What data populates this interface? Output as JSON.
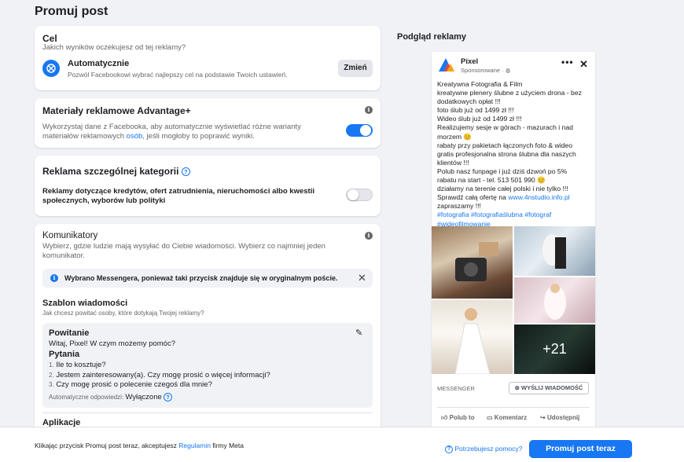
{
  "page": {
    "title": "Promuj post"
  },
  "goal": {
    "title": "Cel",
    "question": "Jakich wyników oczekujesz od tej reklamy?",
    "option_title": "Automatycznie",
    "option_desc": "Pozwól Facebookowi wybrać najlepszy cel na podstawie Twoich ustawień.",
    "change_label": "Zmień"
  },
  "advantage": {
    "title": "Materiały reklamowe Advantage+",
    "desc_1": "Wykorzystaj dane z Facebooka, aby automatycznie wyświetlać różne warianty",
    "desc_2a": "materiałów reklamowych ",
    "desc_link": "osób",
    "desc_2b": ", jeśli mogłoby to poprawić wyniki.",
    "enabled": true
  },
  "special": {
    "title": "Reklama szczególnej kategorii",
    "label_1": "Reklamy dotyczące kredytów, ofert zatrudnienia, nieruchomości albo kwestii",
    "label_2": "społecznych, wyborów lub polityki",
    "enabled": false
  },
  "messenger": {
    "title": "Komunikatory",
    "desc_1": "Wybierz, gdzie ludzie mają wysyłać do Ciebie wiadomości. Wybierz co najmniej jeden",
    "desc_2": "komunikator.",
    "notice": "Wybrano Messengera, ponieważ taki przycisk znajduje się w oryginalnym poście.",
    "template_title": "Szablon wiadomości",
    "template_sub": "Jak chcesz powitać osoby, które dotykają Twojej reklamy?",
    "greeting_title": "Powitanie",
    "greeting_text": "Witaj, Pixel! W czym możemy pomóc?",
    "questions_title": "Pytania",
    "questions": [
      {
        "num": "1.",
        "text": "Ile to kosztuje?"
      },
      {
        "num": "2.",
        "text": "Jestem zainteresowany(a). Czy mogę prosić o więcej informacji?"
      },
      {
        "num": "3.",
        "text": "Czy mogę prosić o polecenie czegoś dla mnie?"
      }
    ],
    "auto_label": "Automatyczne odpowiedzi:",
    "auto_value": "Wyłączone"
  },
  "apps": {
    "title": "Aplikacje"
  },
  "preview": {
    "title": "Podgląd reklamy",
    "page_name": "Pixel",
    "sponsored": "Sponsorowane · ",
    "post_lines": [
      "Kreatywna Fotografia & Film",
      "kreatywne plenery ślubne z użyciem drona - bez",
      "dodatkowych opłat !!!",
      "foto ślub już od 1499 zł !!!",
      "Wideo ślub już od 1499 zł !!!",
      "Realizujemy sesje w górach - mazurach i nad",
      "morzem 😊",
      "rabaty przy pakietach łączonych foto & wideo",
      "gratis profesjonalna strona ślubna dla naszych",
      "klientów !!!",
      "Polub nasz funpage i już dziś dzwoń po 5%",
      "rabatu na start - tel. 513 501 990 😊",
      "działamy na terenie całej polski i nie tylko !!!"
    ],
    "offer_prefix": "Sprawdź całą ofertę na ",
    "offer_link": "www.4nstudio.info.pl",
    "closing": "zapraszamy !!!",
    "hashtags_1": "#fotografia #fotografiaślubna #fotograf",
    "hashtags_2": "#wideofilmowanie",
    "more_photos": "+21",
    "cta_label": "MESSENGER",
    "cta_button": "WYŚLIJ WIADOMOŚĆ",
    "like": "Polub to",
    "comment": "Komentarz",
    "share": "Udostępnij"
  },
  "footer": {
    "text_prefix": "Klikając przycisk Promuj post teraz, akceptujesz ",
    "terms_link": "Regulamin",
    "text_suffix": " firmy Meta",
    "help": "Potrzebujesz pomocy?",
    "promote": "Promuj post teraz"
  },
  "colors": {
    "accent": "#1877f2",
    "background": "#f0f2f5"
  }
}
